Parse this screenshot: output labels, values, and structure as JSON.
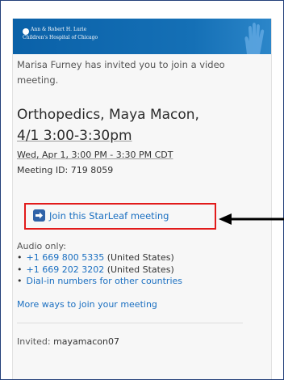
{
  "banner": {
    "logo_line1": "Ann & Robert H. Lurie",
    "logo_line2": "Children's Hospital of Chicago",
    "icon": "hand-logo-icon"
  },
  "invite": {
    "text": "Marisa Furney has invited you to join a video meeting."
  },
  "meeting": {
    "title_line1": "Orthopedics, Maya Macon,",
    "title_line2": "4/1 3:00-3:30pm",
    "date_time": "Wed, Apr 1, 3:00 PM - 3:30 PM CDT",
    "id_label": "Meeting ID:",
    "id_value": "719 8059"
  },
  "join": {
    "icon": "join-arrow-icon",
    "label": "Join this StarLeaf meeting"
  },
  "audio": {
    "label": "Audio only:",
    "numbers": [
      {
        "phone": "+1 669 800 5335",
        "country": "(United States)"
      },
      {
        "phone": "+1 669 202 3202",
        "country": "(United States)"
      }
    ],
    "dial_in_link": "Dial-in numbers for other countries"
  },
  "more_ways": "More ways to join your meeting",
  "invited": {
    "label": "Invited:",
    "value": "mayamacon07"
  },
  "colors": {
    "frame_border": "#24407a",
    "banner": "#1570b6",
    "link": "#1a6fc1",
    "highlight": "#e21b1b"
  }
}
